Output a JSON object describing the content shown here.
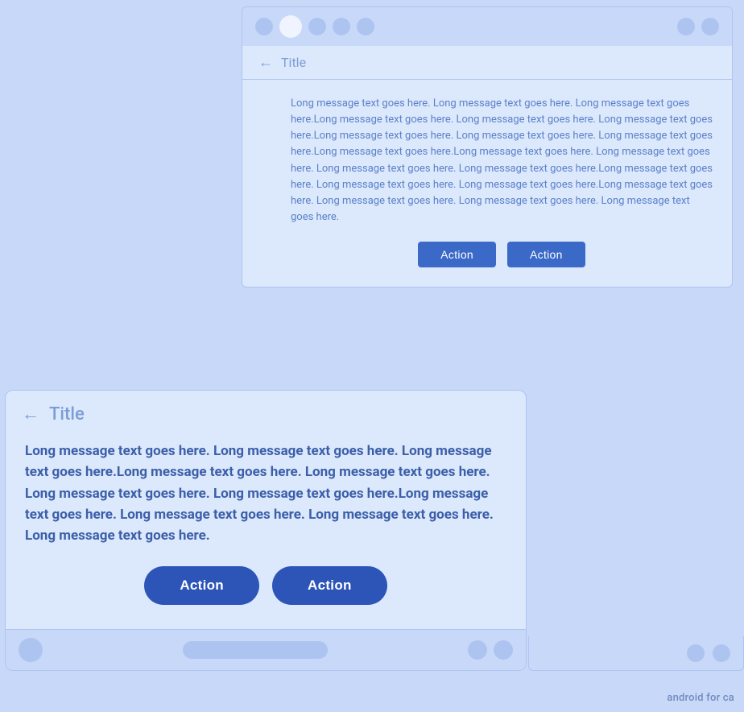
{
  "topPanel": {
    "dots": [
      "circle1",
      "circle2",
      "circle3",
      "circle4",
      "circle5"
    ],
    "titlebar": {
      "backArrow": "←",
      "title": "Title"
    },
    "message": "Long message text goes here. Long message text goes here. Long message text goes here.Long message text goes here. Long message text goes here. Long message text goes here.Long message text goes here. Long message text goes here. Long message text goes here.Long message text goes here.Long message text goes here. Long message text goes here. Long message text goes here. Long message text goes here.Long message text goes here. Long message text goes here. Long message text goes here.Long message text goes here. Long message text goes here. Long message text goes here. Long message text goes here.",
    "buttons": {
      "action1": "Action",
      "action2": "Action"
    }
  },
  "bottomPanel": {
    "titlebar": {
      "backArrow": "←",
      "title": "Title"
    },
    "message": "Long message text goes here. Long message text goes here. Long message text goes here.Long message text goes here. Long message text goes here. Long message text goes here. Long message text goes here.Long message text goes here. Long message text goes here. Long message text goes here. Long message text goes here.",
    "buttons": {
      "action1": "Action",
      "action2": "Action"
    }
  },
  "watermark": "android for ca"
}
